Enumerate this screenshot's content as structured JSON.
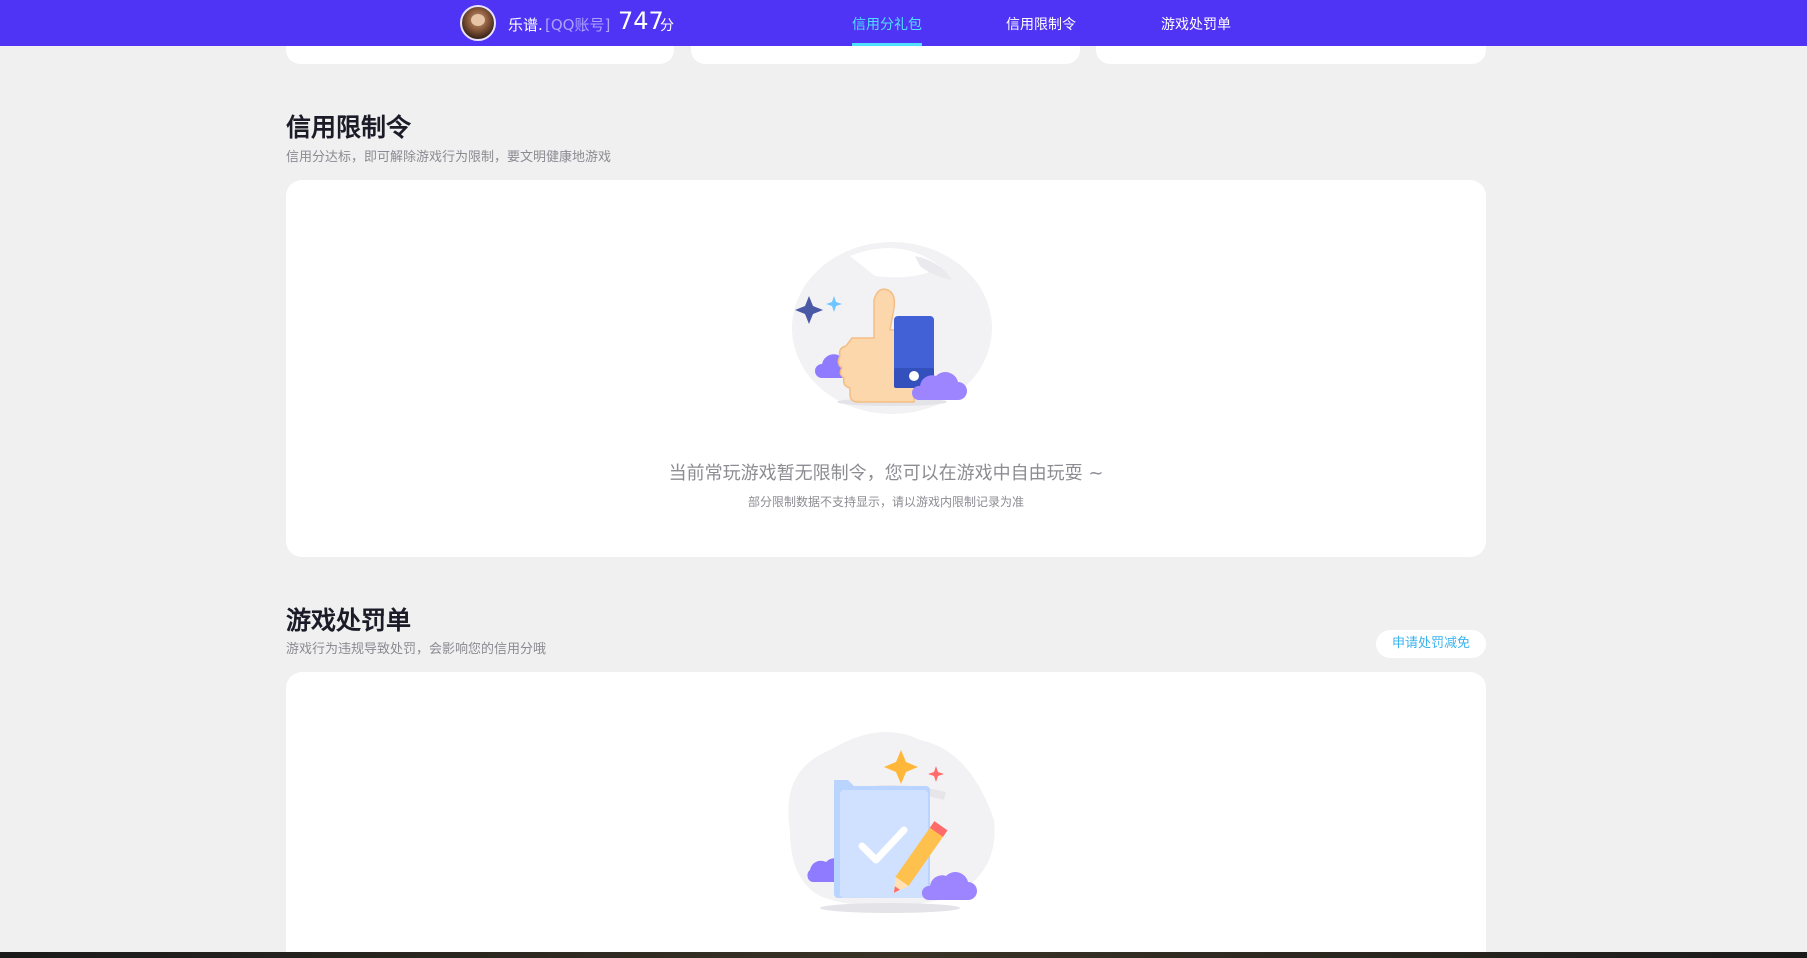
{
  "header": {
    "nickname": "乐谱.",
    "account_type": "[QQ账号]",
    "score": "747",
    "score_unit": "分",
    "nav": [
      {
        "label": "信用分礼包",
        "active": true
      },
      {
        "label": "信用限制令",
        "active": false
      },
      {
        "label": "游戏处罚单",
        "active": false
      }
    ],
    "accent_color": "#4f34f6",
    "active_color": "#4fe0ff"
  },
  "restriction": {
    "title": "信用限制令",
    "subtitle": "信用分达标，即可解除游戏行为限制，要文明健康地游戏",
    "empty_title": "当前常玩游戏暂无限制令，您可以在游戏中自由玩耍 ~",
    "empty_note": "部分限制数据不支持显示，请以游戏内限制记录为准",
    "illustration": "thumbs-up-icon"
  },
  "penalty": {
    "title": "游戏处罚单",
    "subtitle": "游戏行为违规导致处罚，会影响您的信用分哦",
    "appeal_label": "申请处罚减免",
    "illustration": "document-check-icon"
  }
}
